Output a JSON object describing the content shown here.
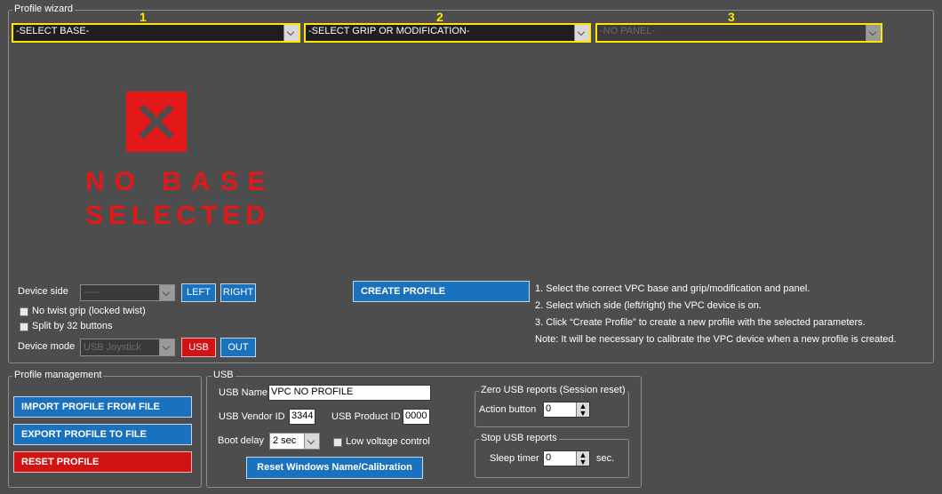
{
  "wizard": {
    "title": "Profile wizard",
    "step_numbers": [
      "1",
      "2",
      "3"
    ],
    "base_select": "-SELECT BASE-",
    "grip_select": "-SELECT GRIP OR MODIFICATION-",
    "panel_select": "-NO PANEL-",
    "no_base_line1": "NO BASE",
    "no_base_line2": "SELECTED",
    "device_side_label": "Device side",
    "device_side_value": "-----",
    "left_button": "LEFT",
    "right_button": "RIGHT",
    "no_twist_label": "No twist grip (locked twist)",
    "split_label": "Split by 32 buttons",
    "device_mode_label": "Device mode",
    "device_mode_value": "USB Joystick",
    "usb_button": "USB",
    "out_button": "OUT",
    "create_button": "CREATE PROFILE",
    "instructions": [
      "1. Select the correct VPC base and grip/modification and panel.",
      "2. Select which side (left/right) the VPC device is on.",
      "3. Click “Create Profile” to create a new profile with the selected parameters.",
      "Note: It will be necessary to calibrate the VPC device when a new profile is created."
    ]
  },
  "profile_management": {
    "title": "Profile management",
    "import_button": "IMPORT PROFILE FROM FILE",
    "export_button": "EXPORT PROFILE TO FILE",
    "reset_button": "RESET PROFILE"
  },
  "usb": {
    "title": "USB",
    "name_label": "USB Name",
    "name_value": "VPC NO PROFILE",
    "vendor_label": "USB Vendor ID",
    "vendor_value": "3344",
    "product_label": "USB Product ID",
    "product_value": "0000",
    "boot_label": "Boot delay",
    "boot_value": "2 sec",
    "low_voltage_label": "Low voltage control",
    "reset_button": "Reset Windows Name/Calibration",
    "zero_reports": {
      "title": "Zero USB reports (Session reset)",
      "action_label": "Action button",
      "action_value": "0"
    },
    "stop_reports": {
      "title": "Stop USB reports",
      "sleep_label": "Sleep timer",
      "sleep_value": "0",
      "sleep_unit": "sec."
    }
  },
  "colors": {
    "background": "#4d4d4d",
    "accent_blue": "#1a72bf",
    "warning_red": "#d01414",
    "highlight_yellow": "#ffe500"
  }
}
